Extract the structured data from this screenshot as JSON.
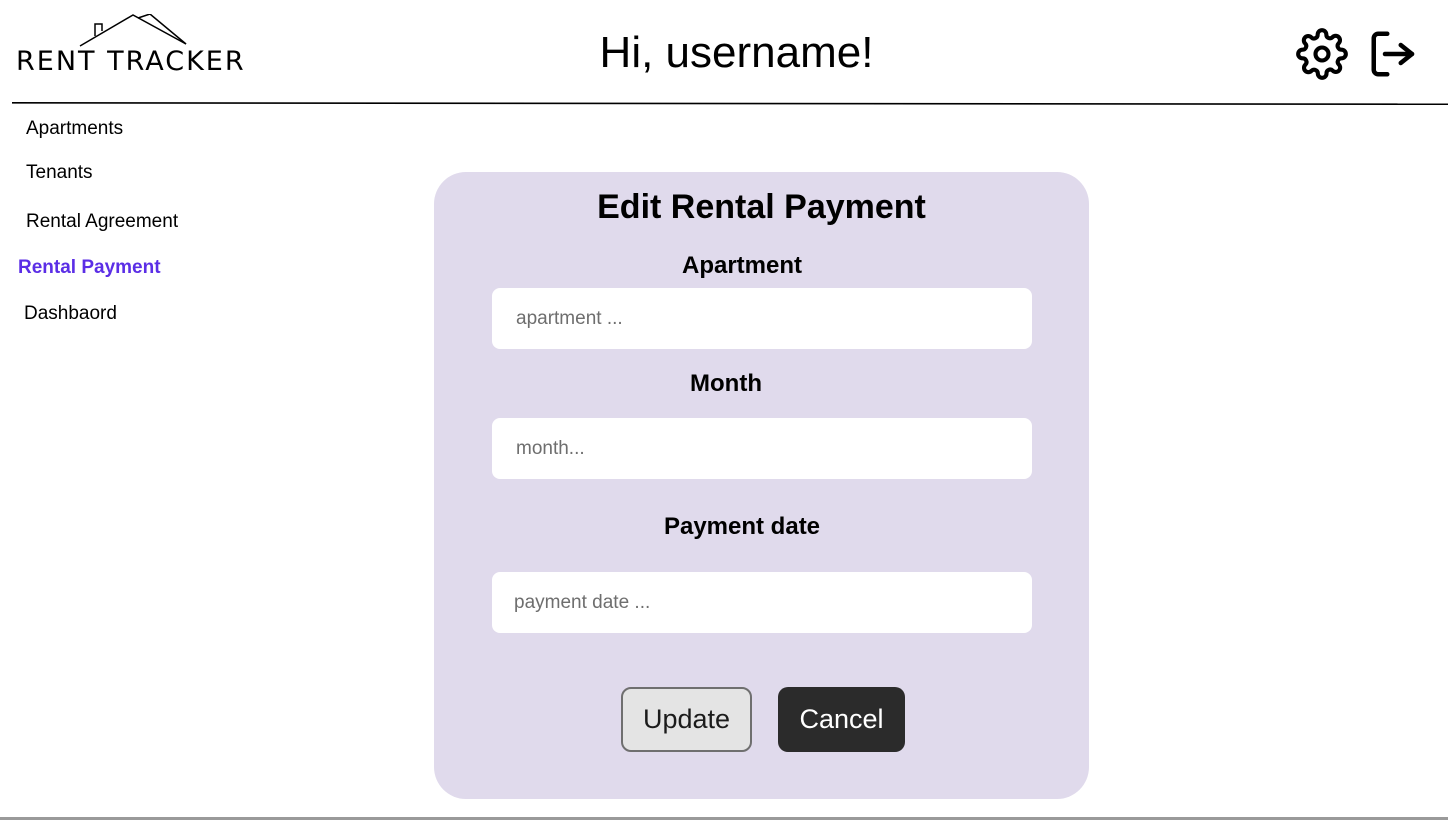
{
  "header": {
    "logo_text": "RENT TRACKER",
    "greeting": "Hi, username!",
    "settings_icon": "gear-icon",
    "logout_icon": "logout-icon"
  },
  "sidebar": {
    "items": [
      {
        "label": "Apartments",
        "active": false
      },
      {
        "label": "Tenants",
        "active": false
      },
      {
        "label": "Rental Agreement",
        "active": false
      },
      {
        "label": "Rental Payment",
        "active": true
      },
      {
        "label": "Dashbaord",
        "active": false
      }
    ]
  },
  "form": {
    "title": "Edit Rental Payment",
    "fields": [
      {
        "label": "Apartment",
        "placeholder": "apartment ...",
        "value": ""
      },
      {
        "label": "Month",
        "placeholder": "month...",
        "value": ""
      },
      {
        "label": "Payment date",
        "placeholder": "payment date ...",
        "value": ""
      }
    ],
    "update_label": "Update",
    "cancel_label": "Cancel"
  },
  "colors": {
    "accent": "#5b2ee6",
    "card_background": "#e0daec",
    "cancel_button": "#2b2b2b",
    "update_button": "#e4e4e4"
  }
}
